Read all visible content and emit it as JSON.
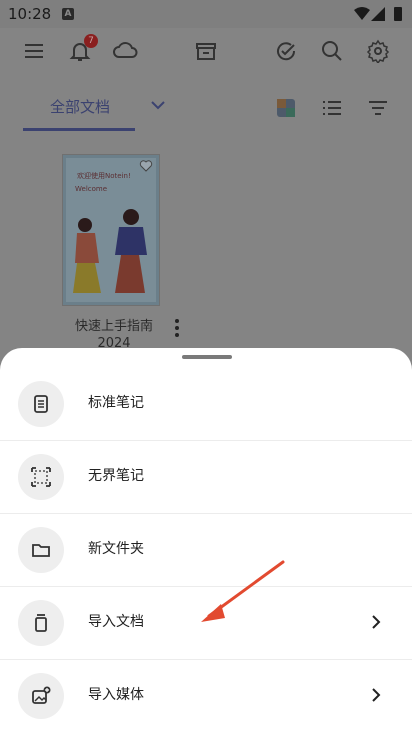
{
  "status_bar": {
    "time": "10:28",
    "app_icon_letter": "A"
  },
  "top_bar": {
    "notification_count": "7"
  },
  "tabs": {
    "current": "全部文档"
  },
  "document": {
    "name": "快速上手指南2024",
    "cover_title": "欢迎使用Notein!",
    "cover_subtitle": "Welcome"
  },
  "sheet": {
    "items": [
      {
        "label": "标准笔记",
        "icon": "note-icon",
        "has_chevron": false
      },
      {
        "label": "无界笔记",
        "icon": "infinite-canvas-icon",
        "has_chevron": false
      },
      {
        "label": "新文件夹",
        "icon": "folder-icon",
        "has_chevron": false
      },
      {
        "label": "导入文档",
        "icon": "import-document-icon",
        "has_chevron": true
      },
      {
        "label": "导入媒体",
        "icon": "import-media-icon",
        "has_chevron": true
      }
    ]
  },
  "colors": {
    "accent": "#3b4270",
    "annotation_arrow": "#e24a30",
    "overlay": "#848484"
  }
}
